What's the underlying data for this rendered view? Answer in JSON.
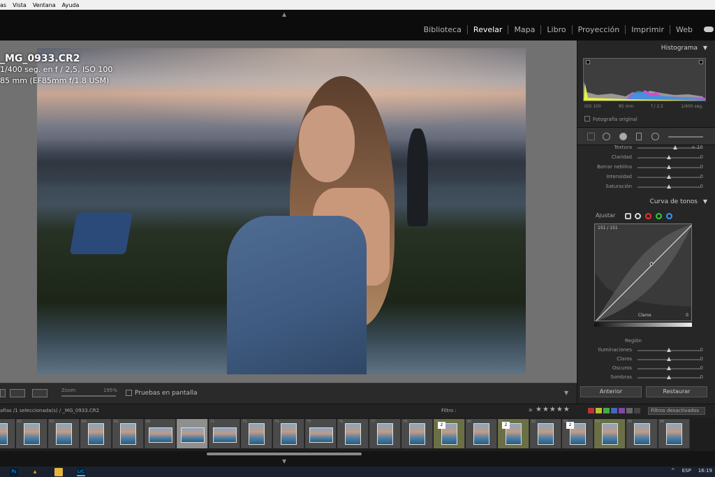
{
  "menu": {
    "items": [
      "as",
      "Vista",
      "Ventana",
      "Ayuda"
    ]
  },
  "modules": {
    "items": [
      "Biblioteca",
      "Revelar",
      "Mapa",
      "Libro",
      "Proyección",
      "Imprimir",
      "Web"
    ],
    "active": "Revelar"
  },
  "photo_info": {
    "filename": "_MG_0933.CR2",
    "exposure": "1/400 seg. en f / 2,5, ISO 100",
    "lens": "85 mm (EF85mm f/1.8 USM)"
  },
  "toolbar": {
    "zoom_label": "Zoom",
    "zoom_value": "195%",
    "proof_label": "Pruebas en pantalla"
  },
  "histogram": {
    "title": "Histograma",
    "info": [
      "ISO 100",
      "85 mm",
      "f / 2,5",
      "1/400 seg."
    ],
    "original_label": "Fotografía original"
  },
  "presence": {
    "sliders": [
      {
        "label": "Textura",
        "value": "+ 16",
        "pos": 0.6
      },
      {
        "label": "Claridad",
        "value": "0",
        "pos": 0.5
      },
      {
        "label": "Borrar neblina",
        "value": "0",
        "pos": 0.5
      },
      {
        "label": "Intensidad",
        "value": "0",
        "pos": 0.5
      },
      {
        "label": "Saturación",
        "value": "0",
        "pos": 0.5
      }
    ]
  },
  "tone_curve": {
    "title": "Curva de tonos",
    "adjust_label": "Ajustar",
    "readout": "151 / 151",
    "hover_label": "Claros",
    "bottom_value": "0",
    "region_title": "Región",
    "region_sliders": [
      {
        "label": "Iluminaciones",
        "value": "0",
        "pos": 0.5
      },
      {
        "label": "Claros",
        "value": "0",
        "pos": 0.5
      },
      {
        "label": "Oscuros",
        "value": "0",
        "pos": 0.5
      },
      {
        "label": "Sombras",
        "value": "0",
        "pos": 0.5
      }
    ]
  },
  "panel_buttons": {
    "previous": "Anterior",
    "reset": "Restaurar"
  },
  "filter_bar": {
    "path": "afías /1 seleccionada(s) / _MG_0933.CR2",
    "filter_label": "Filtro :",
    "ge": "≥",
    "stars": "★★★★★",
    "filters_off": "Filtros desactivados"
  },
  "filmstrip": {
    "numbers": [
      "",
      "62",
      "63",
      "64",
      "65",
      "66",
      "71",
      "72",
      "73",
      "74",
      "75",
      "76",
      "77",
      "78",
      "79",
      "80",
      "81",
      "82",
      "83",
      "84",
      "85",
      "86"
    ],
    "selected_index": 6,
    "green_indices": [
      14,
      16,
      19
    ],
    "badge_indices": [
      14,
      16,
      18
    ],
    "badge_text": "2"
  },
  "taskbar": {
    "lang": "ESP",
    "time": "16:19",
    "ps": "Ps",
    "lrc": "LrC"
  },
  "colors": {
    "accent": "#ffffff",
    "panel": "#262626",
    "viewer": "#717171"
  }
}
